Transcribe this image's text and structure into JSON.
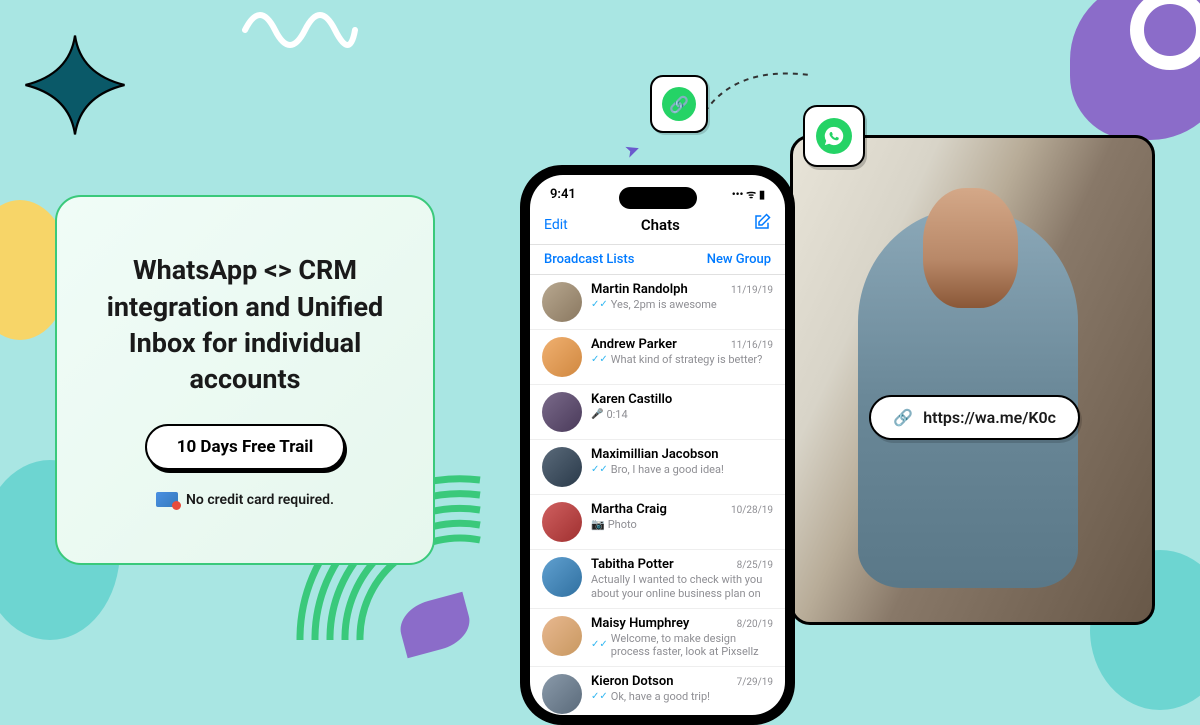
{
  "promo": {
    "title": "WhatsApp <> CRM integration and Unified Inbox for individual accounts",
    "cta_label": "10 Days Free Trail",
    "no_cc_text": "No credit card required."
  },
  "phone": {
    "time": "9:41",
    "nav_edit": "Edit",
    "nav_title": "Chats",
    "broadcast": "Broadcast Lists",
    "new_group": "New Group"
  },
  "chats": [
    {
      "name": "Martin Randolph",
      "date": "11/19/19",
      "msg": "Yes, 2pm is awesome",
      "check": true
    },
    {
      "name": "Andrew Parker",
      "date": "11/16/19",
      "msg": "What kind of strategy is better?",
      "check": true
    },
    {
      "name": "Karen Castillo",
      "date": "",
      "msg": "0:14",
      "voice": true
    },
    {
      "name": "Maximillian Jacobson",
      "date": "",
      "msg": "Bro, I have a good idea!",
      "check": true
    },
    {
      "name": "Martha Craig",
      "date": "10/28/19",
      "msg": "Photo",
      "photo": true
    },
    {
      "name": "Tabitha Potter",
      "date": "8/25/19",
      "msg": "Actually I wanted to check with you about your online business plan on"
    },
    {
      "name": "Maisy Humphrey",
      "date": "8/20/19",
      "msg": "Welcome, to make design process faster, look at Pixsellz",
      "check": true
    },
    {
      "name": "Kieron Dotson",
      "date": "7/29/19",
      "msg": "Ok, have a good trip!",
      "check": true
    }
  ],
  "url": "https://wa.me/K0c"
}
